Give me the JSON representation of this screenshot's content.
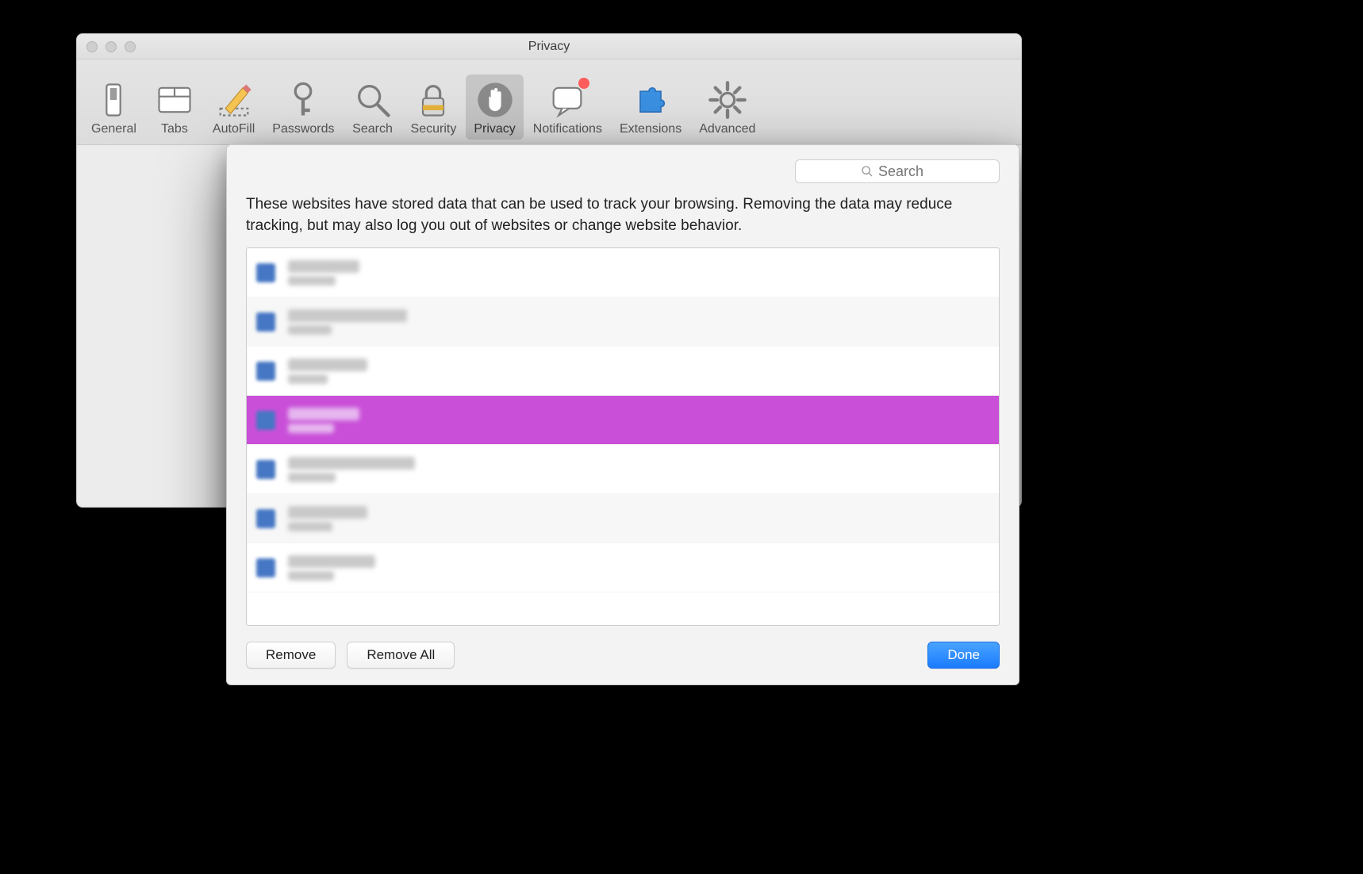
{
  "window": {
    "title": "Privacy"
  },
  "toolbar": {
    "items": [
      {
        "label": "General",
        "icon": "switch"
      },
      {
        "label": "Tabs",
        "icon": "tabs"
      },
      {
        "label": "AutoFill",
        "icon": "pencil"
      },
      {
        "label": "Passwords",
        "icon": "key"
      },
      {
        "label": "Search",
        "icon": "magnifier"
      },
      {
        "label": "Security",
        "icon": "lock"
      },
      {
        "label": "Privacy",
        "icon": "hand",
        "active": true
      },
      {
        "label": "Notifications",
        "icon": "speech",
        "badge": true
      },
      {
        "label": "Extensions",
        "icon": "puzzle"
      },
      {
        "label": "Advanced",
        "icon": "gear"
      }
    ]
  },
  "help_button": {
    "glyph": "?"
  },
  "sheet": {
    "search_placeholder": "Search",
    "description": "These websites have stored data that can be used to track your browsing. Removing the data may reduce tracking, but may also log you out of websites or change website behavior.",
    "sites": [
      {
        "w1": 90,
        "w2": 60,
        "selected": false
      },
      {
        "w1": 150,
        "w2": 55,
        "selected": false
      },
      {
        "w1": 100,
        "w2": 50,
        "selected": false
      },
      {
        "w1": 90,
        "w2": 58,
        "selected": true
      },
      {
        "w1": 160,
        "w2": 60,
        "selected": false
      },
      {
        "w1": 100,
        "w2": 56,
        "selected": false
      },
      {
        "w1": 110,
        "w2": 58,
        "selected": false
      }
    ],
    "remove_label": "Remove",
    "remove_all_label": "Remove All",
    "done_label": "Done"
  }
}
